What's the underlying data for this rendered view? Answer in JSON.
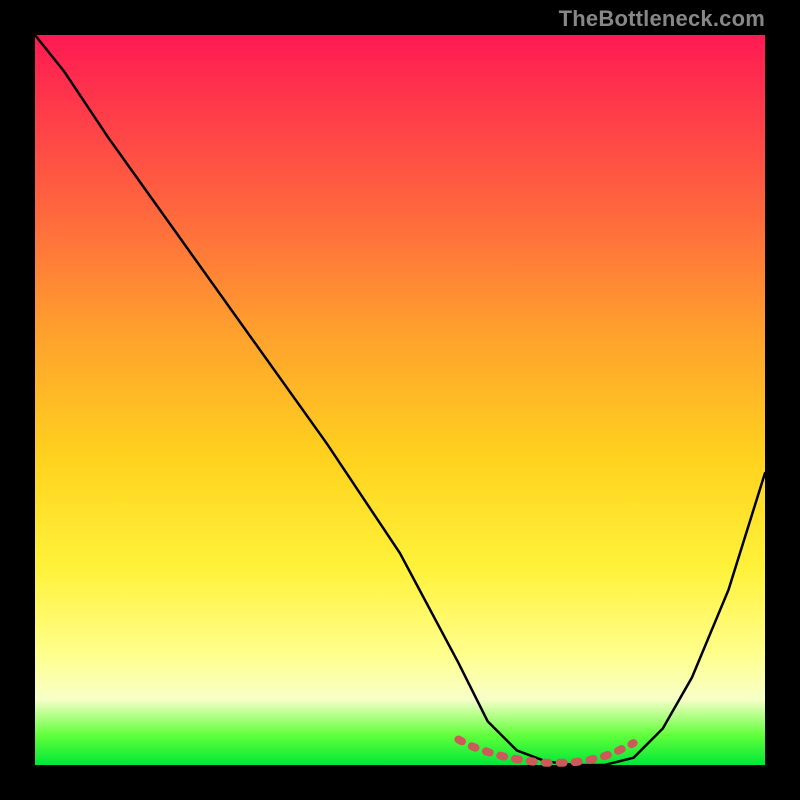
{
  "watermark": "TheBottleneck.com",
  "chart_data": {
    "type": "line",
    "title": "",
    "xlabel": "",
    "ylabel": "",
    "xlim": [
      0,
      100
    ],
    "ylim": [
      0,
      100
    ],
    "grid": false,
    "legend": false,
    "series": [
      {
        "name": "bottleneck-curve",
        "color": "#000000",
        "x": [
          0,
          4,
          10,
          20,
          30,
          40,
          50,
          58,
          62,
          66,
          70,
          74,
          78,
          82,
          86,
          90,
          95,
          100
        ],
        "y": [
          100,
          95,
          86,
          72,
          58,
          44,
          29,
          14,
          6,
          2,
          0.5,
          0,
          0,
          1,
          5,
          12,
          24,
          40
        ]
      }
    ],
    "markers": {
      "name": "highlight-dash",
      "color": "#cc5a5a",
      "x": [
        58,
        60,
        62,
        64,
        66,
        68,
        70,
        72,
        74,
        76,
        78,
        80,
        82
      ],
      "y": [
        3.5,
        2.5,
        1.8,
        1.2,
        0.8,
        0.5,
        0.3,
        0.3,
        0.4,
        0.7,
        1.2,
        2.0,
        3.0
      ]
    },
    "gradient_stops": [
      {
        "pos": 0,
        "color": "#ff1a53"
      },
      {
        "pos": 10,
        "color": "#ff3a4a"
      },
      {
        "pos": 25,
        "color": "#ff6a3d"
      },
      {
        "pos": 40,
        "color": "#ff9e2e"
      },
      {
        "pos": 58,
        "color": "#ffd21e"
      },
      {
        "pos": 73,
        "color": "#fff23a"
      },
      {
        "pos": 85,
        "color": "#ffff8e"
      },
      {
        "pos": 91,
        "color": "#f7ffc8"
      },
      {
        "pos": 96,
        "color": "#5fff3a"
      },
      {
        "pos": 100,
        "color": "#00e838"
      }
    ]
  }
}
